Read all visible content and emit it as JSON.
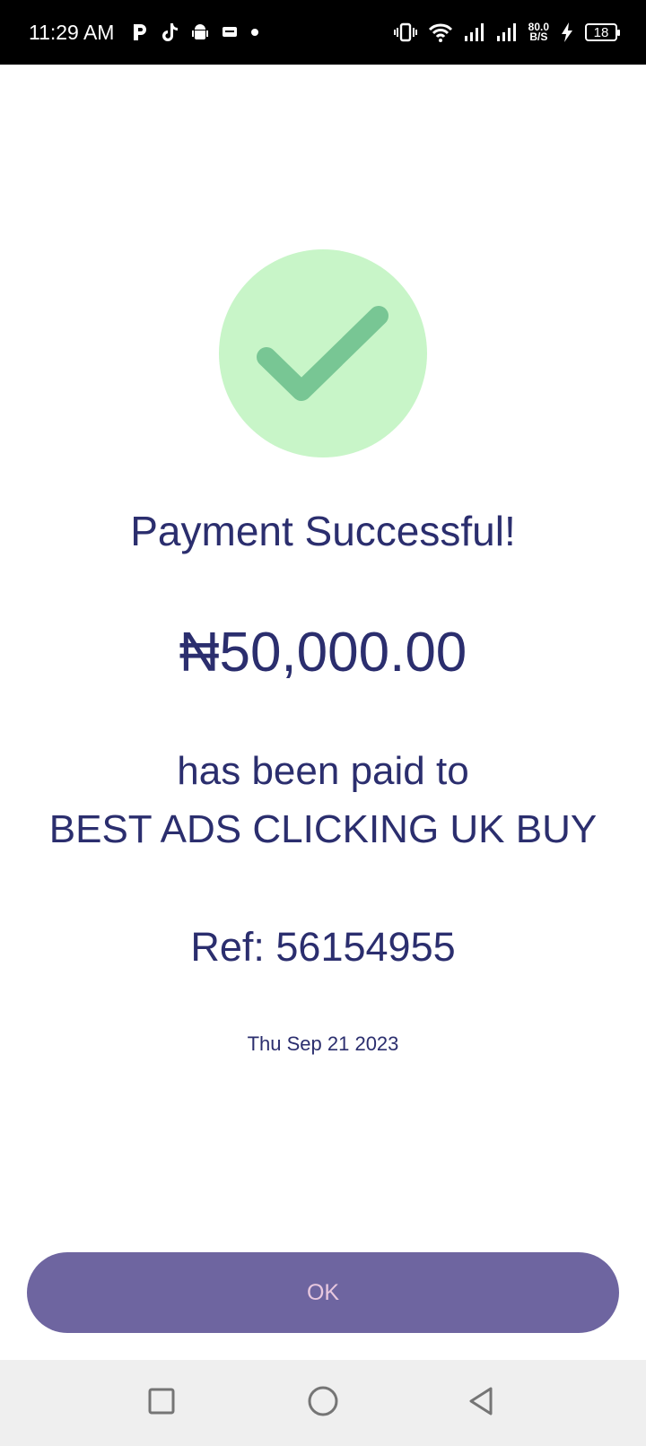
{
  "status_bar": {
    "time": "11:29 AM",
    "net_speed_value": "80.0",
    "net_speed_unit": "B/S",
    "battery": "18",
    "notification_icons": [
      "p-app-icon",
      "tiktok-icon",
      "android-icon",
      "message-icon",
      "dot-icon"
    ],
    "system_icons": [
      "vibrate-icon",
      "wifi-icon",
      "signal-icon",
      "signal-icon",
      "charging-icon"
    ]
  },
  "success": {
    "title": "Payment Successful!",
    "amount": "₦50,000.00",
    "paid_to_label": "has been paid to",
    "recipient": "BEST ADS CLICKING UK BUY",
    "reference": "Ref: 56154955",
    "date": "Thu Sep 21 2023"
  },
  "actions": {
    "ok_label": "OK"
  },
  "colors": {
    "text": "#2b2e6e",
    "check_bg": "#c8f5c8",
    "check_mark": "#78c694",
    "button_bg": "#6e65a0",
    "button_text": "#e8c8df"
  },
  "nav": {
    "buttons": [
      "recent-apps-icon",
      "home-icon",
      "back-icon"
    ]
  }
}
